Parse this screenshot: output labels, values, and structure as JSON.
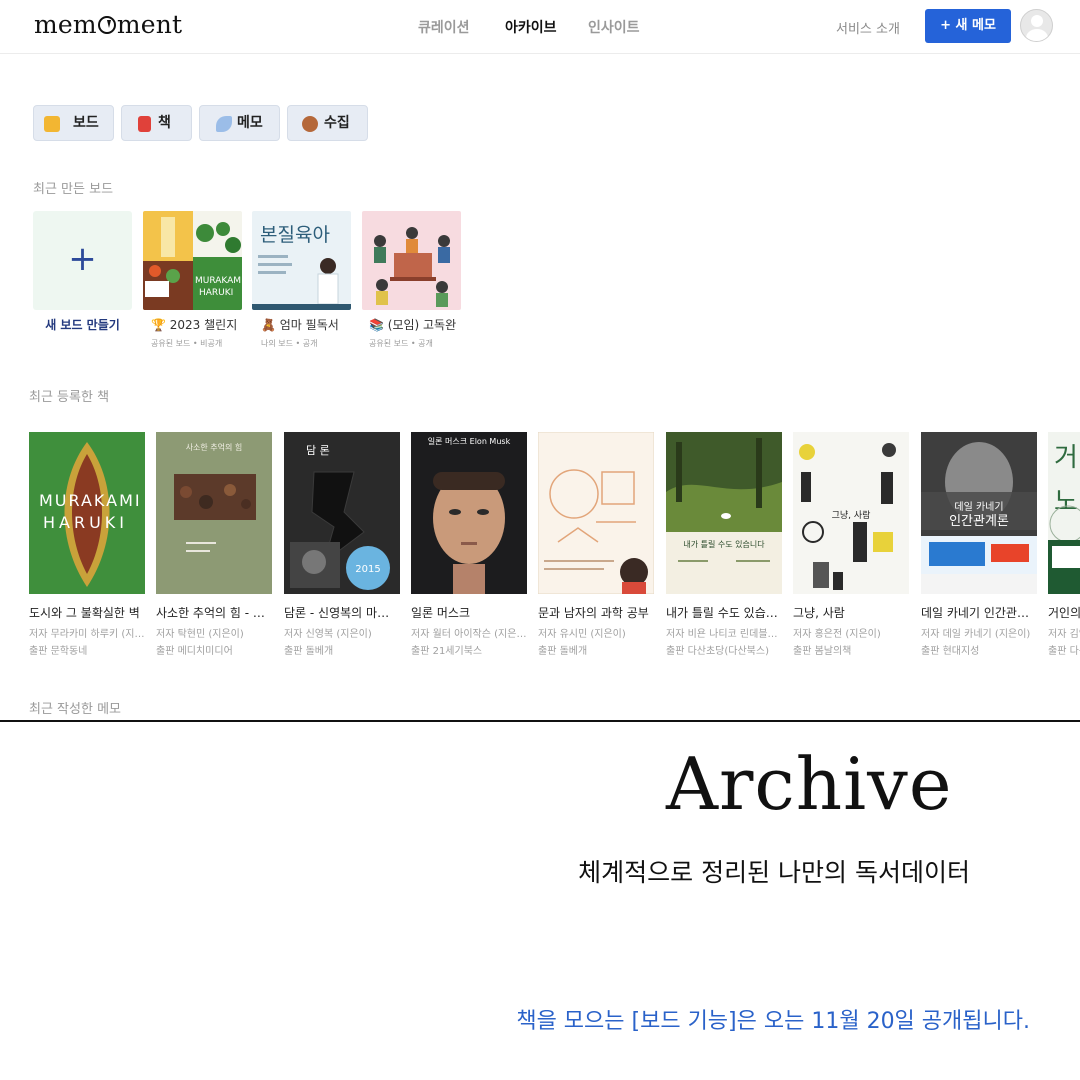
{
  "header": {
    "logo": "memoment",
    "nav": [
      "큐레이션",
      "아카이브",
      "인사이트"
    ],
    "intro_link": "서비스 소개",
    "new_memo_button": "+ 새 메모"
  },
  "tabs": [
    {
      "label": "보드",
      "icon": "folder-icon"
    },
    {
      "label": "책",
      "icon": "book-icon"
    },
    {
      "label": "메모",
      "icon": "feather-icon"
    },
    {
      "label": "수집",
      "icon": "squirrel-icon"
    }
  ],
  "boards_section": {
    "label": "최근 만든 보드",
    "new_board_label": "새 보드 만들기",
    "boards": [
      {
        "title": "🏆 2023 챌린지",
        "meta": "공유된 보드 • 비공개"
      },
      {
        "title": "🧸 엄마 필독서",
        "meta": "나의 보드 • 공개"
      },
      {
        "title": "📚 (모임) 고독완",
        "meta": "공유된 보드 • 공개"
      }
    ],
    "board_thumb_texts": {
      "b2_title": "본질육아"
    }
  },
  "books_section": {
    "label": "최근 등록한 책",
    "books": [
      {
        "title": "도시와 그 불확실한 벽",
        "author": "저자 무라카미 하루키 (지은이)",
        "publisher": "출판 문학동네",
        "cover_text": "MURAKAMI HARUKI"
      },
      {
        "title": "사소한 추억의 힘 - 탁현민",
        "author": "저자 탁현민 (지은이)",
        "publisher": "출판 메디치미디어",
        "cover_text": "사소한 추억의 힘"
      },
      {
        "title": "담론 - 신영복의 마지막 강의",
        "author": "저자 신영복 (지은이)",
        "publisher": "출판 돌베개",
        "cover_text": "담 론"
      },
      {
        "title": "일론 머스크",
        "author": "저자 월터 아이작슨 (지은이)",
        "publisher": "출판 21세기북스",
        "cover_text": "일론 머스크 Elon Musk"
      },
      {
        "title": "문과 남자의 과학 공부",
        "author": "저자 유시민 (지은이)",
        "publisher": "출판 돌베개",
        "cover_text": ""
      },
      {
        "title": "내가 틀릴 수도 있습니다",
        "author": "저자 비욘 나티코 린데블라드",
        "publisher": "출판 다산초당(다산북스)",
        "cover_text": "내가 틀릴 수도 있습니다"
      },
      {
        "title": "그냥, 사람",
        "author": "저자 홍은전 (지은이)",
        "publisher": "출판 봄날의책",
        "cover_text": "그냥, 사람"
      },
      {
        "title": "데일 카네기 인간관계론",
        "author": "저자 데일 카네기 (지은이)",
        "publisher": "출판 현대지성",
        "cover_text": "데일 카네기 인간관계론"
      },
      {
        "title": "거인의 노트",
        "author": "저자 김익한 (지은이)",
        "publisher": "출판 다산북스",
        "cover_text": "거인의 노트"
      }
    ]
  },
  "memos_section": {
    "label": "최근 작성한 메모"
  },
  "promo": {
    "headline": "Archive",
    "subtitle": "체계적으로 정리된 나만의 독서데이터",
    "notice": "책을 모으는 [보드 기능]은 오는 11월 20일 공개됩니다."
  }
}
